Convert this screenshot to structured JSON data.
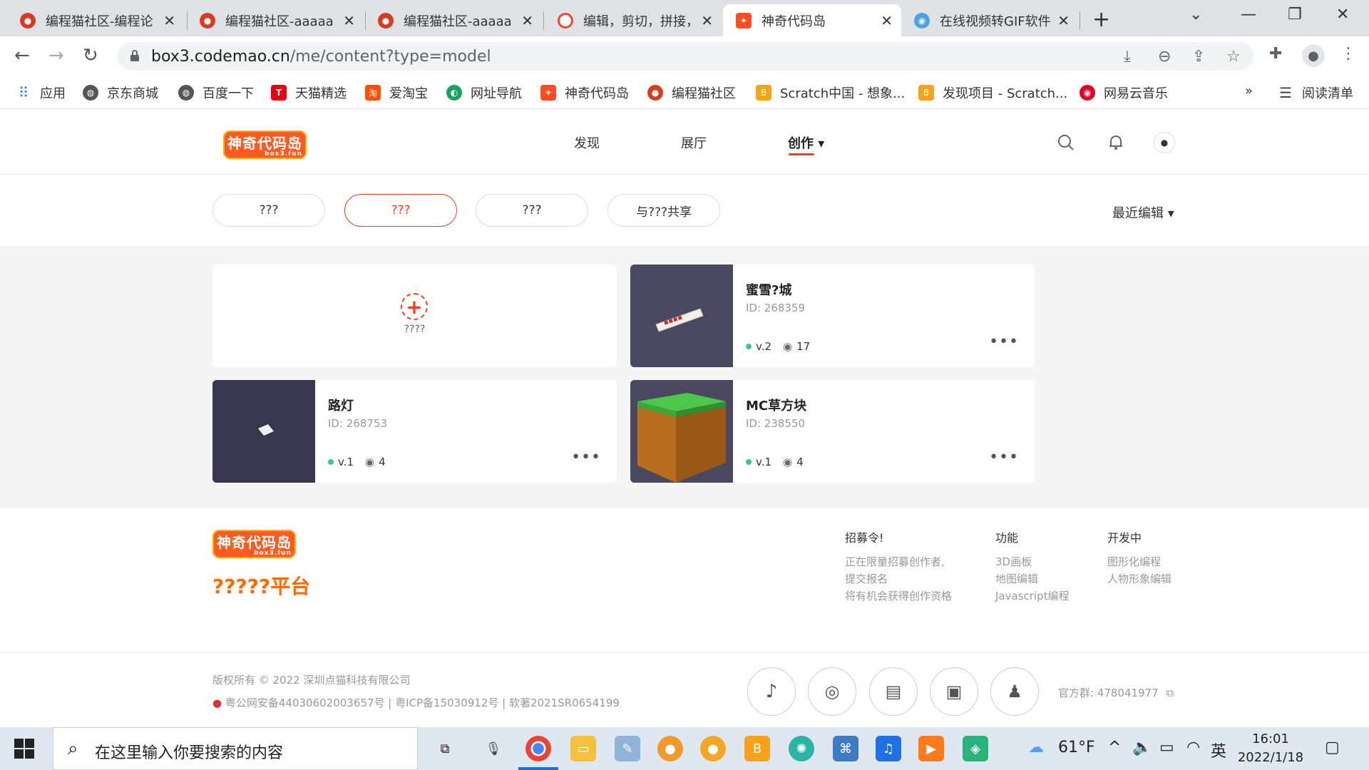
{
  "browser": {
    "tabs": [
      {
        "title": "编程猫社区-编程论",
        "favicon": "codemao-icon",
        "active": false
      },
      {
        "title": "编程猫社区-aaaaa",
        "favicon": "codemao-icon",
        "active": false
      },
      {
        "title": "编程猫社区-aaaaa",
        "favicon": "codemao-icon",
        "active": false
      },
      {
        "title": "编辑，剪切，拼接，",
        "favicon": "editor-icon",
        "active": false
      },
      {
        "title": "神奇代码岛",
        "favicon": "box3-icon",
        "active": true
      },
      {
        "title": "在线视频转GIF软件",
        "favicon": "gif-icon",
        "active": false
      }
    ],
    "url": "box3.codemao.cn",
    "url_path": "/me/content?type=model",
    "bookmarks": [
      {
        "label": "应用",
        "icon": "apps-grid-icon"
      },
      {
        "label": "京东商城",
        "icon": "globe-icon"
      },
      {
        "label": "百度一下",
        "icon": "globe-icon"
      },
      {
        "label": "天猫精选",
        "icon": "tmall-icon"
      },
      {
        "label": "爱淘宝",
        "icon": "taobao-icon"
      },
      {
        "label": "网址导航",
        "icon": "nav-icon"
      },
      {
        "label": "神奇代码岛",
        "icon": "box3-icon"
      },
      {
        "label": "编程猫社区",
        "icon": "codemao-icon"
      },
      {
        "label": "Scratch中国 - 想象...",
        "icon": "scratch-icon"
      },
      {
        "label": "发现项目 - Scratch...",
        "icon": "scratch-icon"
      },
      {
        "label": "网易云音乐",
        "icon": "netease-music-icon"
      }
    ],
    "bookmarks_more": "»",
    "reading_list": "阅读清单"
  },
  "site": {
    "logo_text": "神奇代码岛",
    "logo_sub": "box3.fun",
    "nav": [
      {
        "label": "发现"
      },
      {
        "label": "展厅"
      },
      {
        "label": "创作 ▾"
      }
    ]
  },
  "filters": {
    "pills": [
      "???",
      "???",
      "???",
      "与???共享"
    ],
    "active_index": 1,
    "sort_label": "最近编辑 ▾"
  },
  "new_card": {
    "label": "????"
  },
  "models": [
    {
      "title": "蜜雪?城",
      "id": "ID: 268359",
      "version": "v.2",
      "views": "17"
    },
    {
      "title": "路灯",
      "id": "ID: 268753",
      "version": "v.1",
      "views": "4"
    },
    {
      "title": "MC草方块",
      "id": "ID: 238550",
      "version": "v.1",
      "views": "4"
    }
  ],
  "footer": {
    "slogan": "?????平台",
    "columns": [
      {
        "title": "招募令!",
        "items": [
          "正在限量招募创作者,",
          "提交报名",
          "将有机会获得创作资格"
        ]
      },
      {
        "title": "功能",
        "items": [
          "3D画板",
          "地图编辑",
          "Javascript编程"
        ]
      },
      {
        "title": "开发中",
        "items": [
          "图形化编程",
          "人物形象编辑"
        ]
      }
    ],
    "copyright": "版权所有 © 2022 深圳点猫科技有限公司",
    "license": "粤公网安备44030602003657号  |  粤ICP备15030912号  |  软著2021SR0654199",
    "qq_group": "官方群: 478041977"
  },
  "taskbar": {
    "search_placeholder": "在这里输入你要搜索的内容",
    "weather": "61°F",
    "ime": "英",
    "time": "16:01",
    "date": "2022/1/18"
  },
  "colors": {
    "accent": "#ff3b1f",
    "brand_orange": "#ff6a00",
    "status_green": "#44c28d"
  }
}
